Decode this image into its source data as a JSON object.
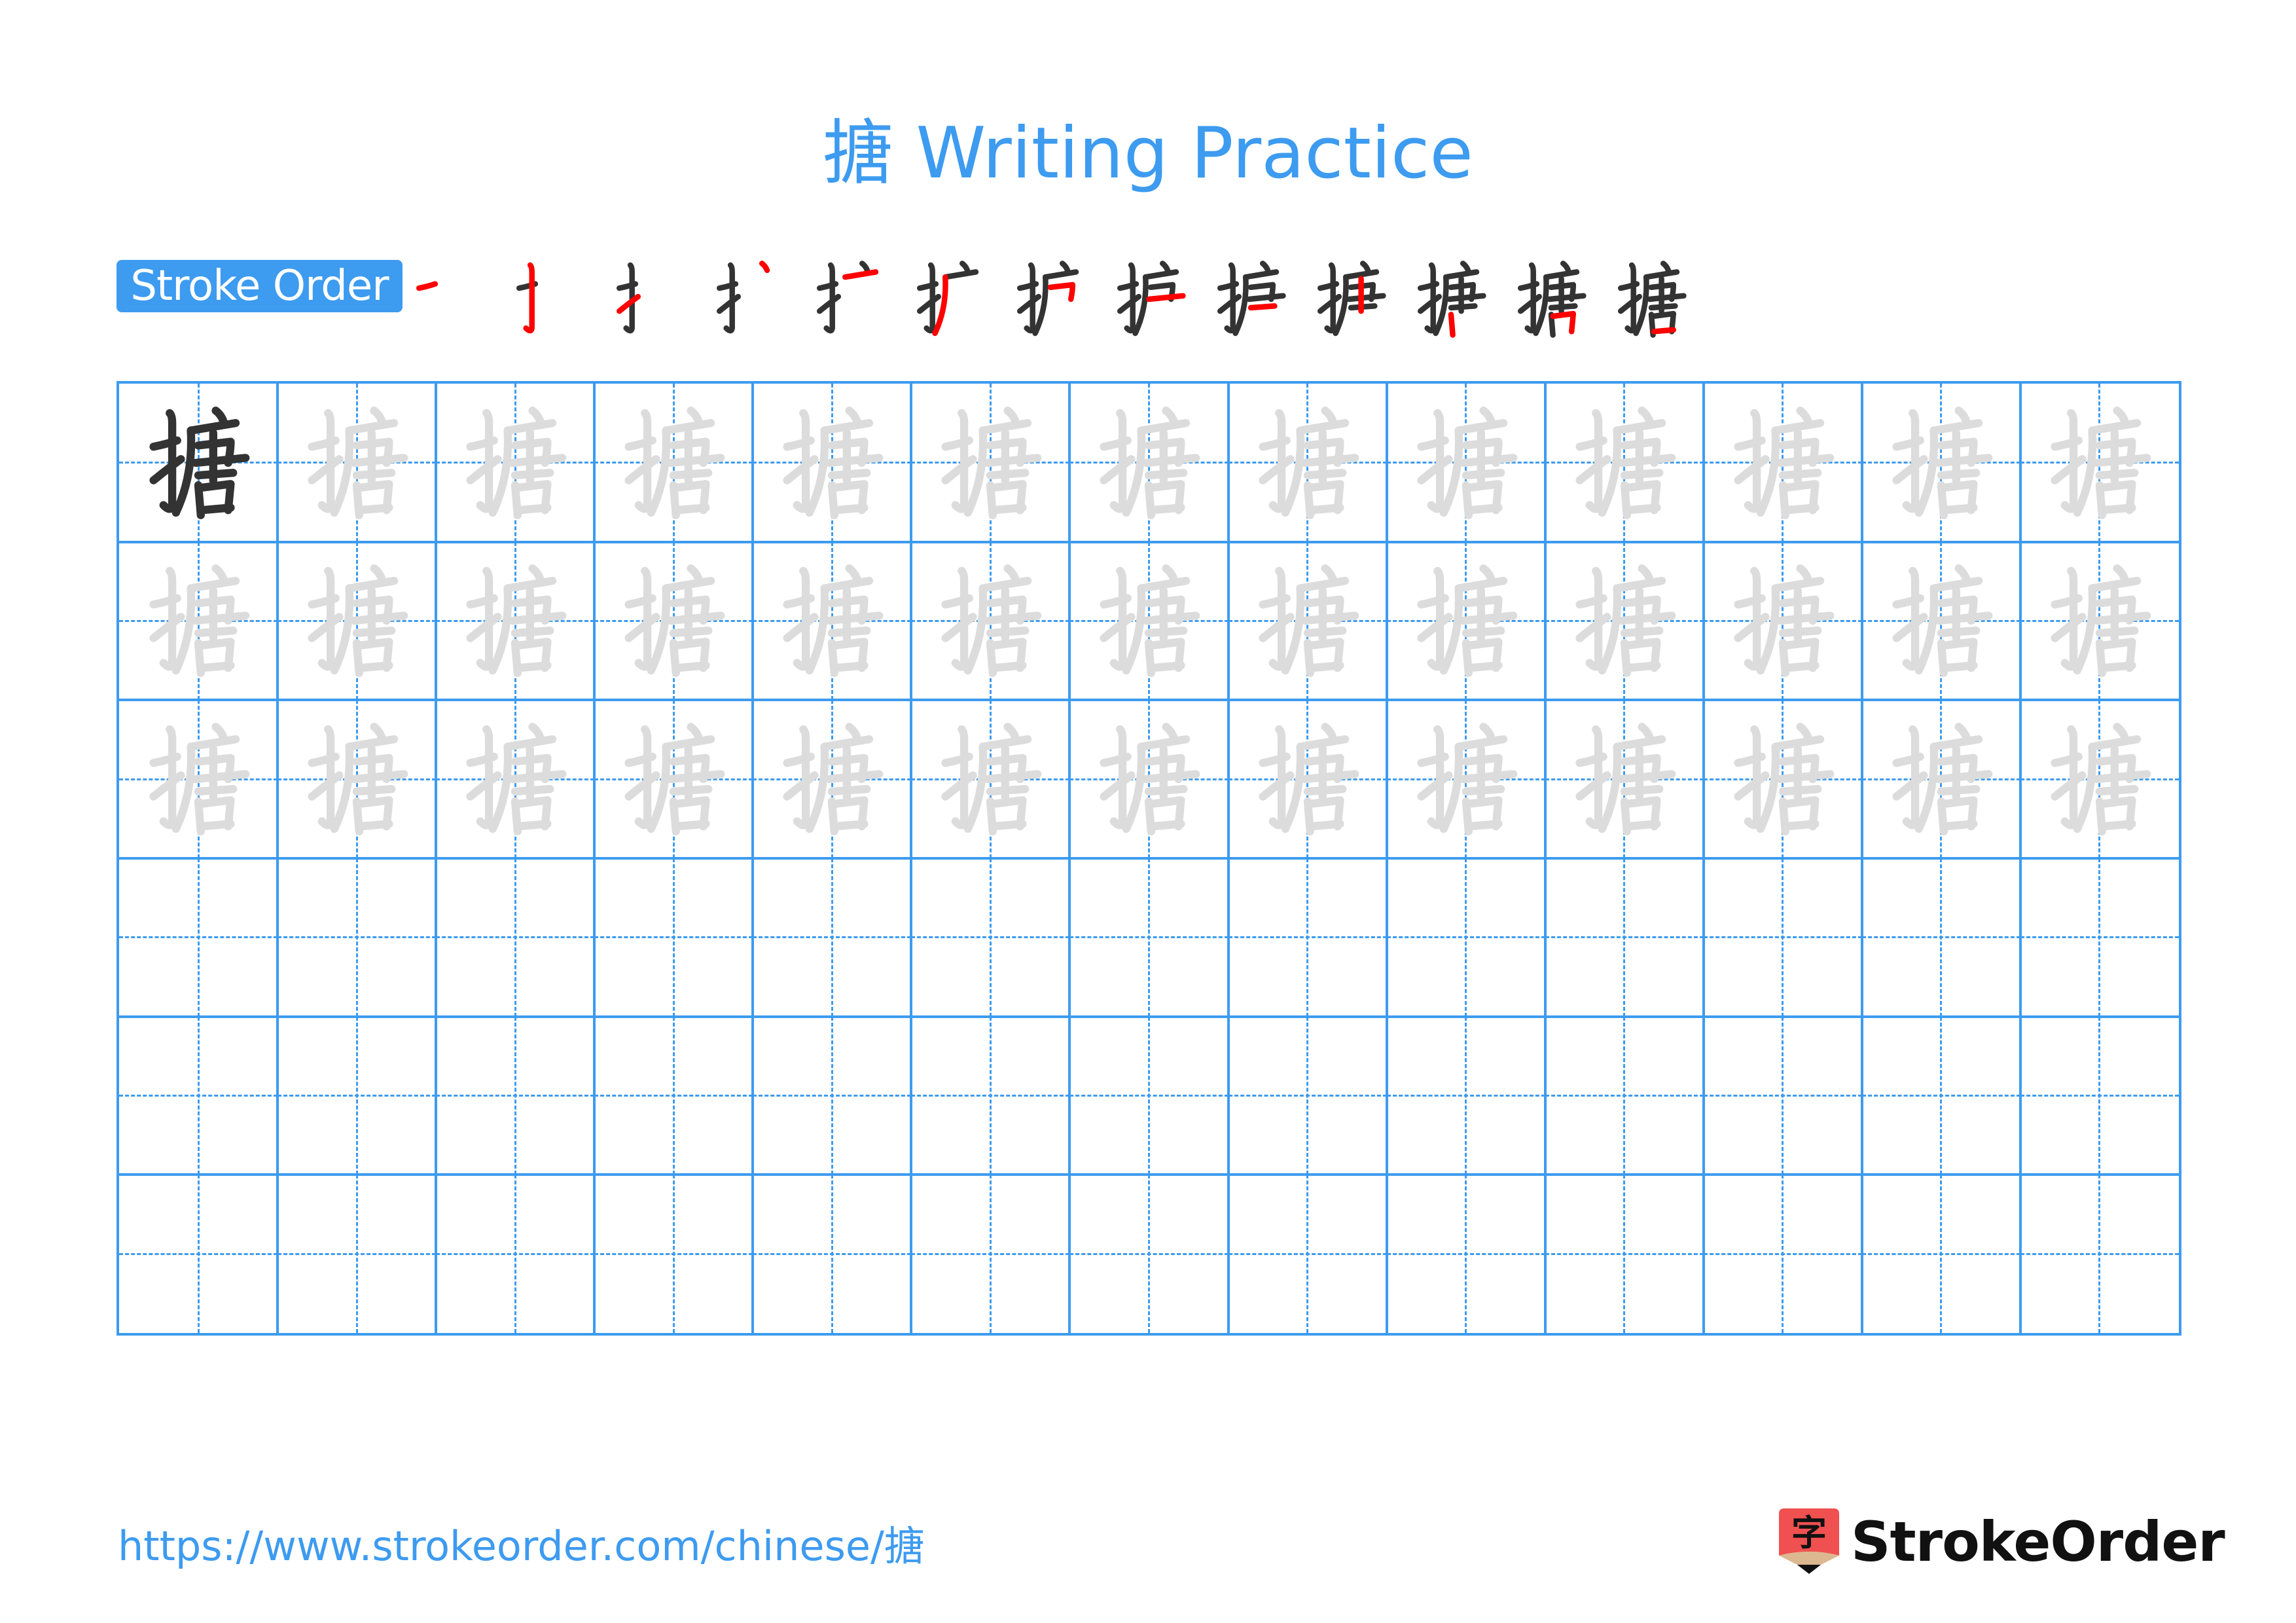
{
  "page": {
    "title": "搪 Writing Practice",
    "character": "搪"
  },
  "stroke_order": {
    "label": "Stroke Order",
    "total_strokes": 13,
    "steps": [
      1,
      2,
      3,
      4,
      5,
      6,
      7,
      8,
      9,
      10,
      11,
      12,
      13
    ],
    "colors": {
      "drawn": "#333333",
      "current": "#ff0000"
    }
  },
  "practice_grid": {
    "rows": 6,
    "columns": 13,
    "row_modes": [
      "model-then-trace",
      "trace",
      "trace",
      "blank",
      "blank",
      "blank"
    ],
    "colors": {
      "grid": "#3d9bf0",
      "model": "#333333",
      "trace": "#dcdcdc"
    }
  },
  "footer": {
    "url": "https://www.strokeorder.com/chinese/搪",
    "brand": "StrokeOrder",
    "logo_glyph": "字",
    "colors": {
      "logo_red": "#f05050",
      "logo_tan": "#dcb890",
      "brand_text": "#111111"
    }
  }
}
